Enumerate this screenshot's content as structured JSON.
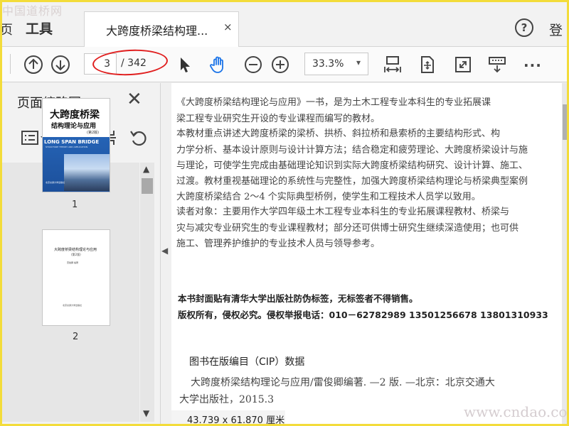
{
  "watermark": {
    "top": "中国道桥网",
    "bottom": "www.cndao.com"
  },
  "titlebar": {
    "left_stub": "页",
    "tools_tab": "工具",
    "doc_tab_title": "大跨度桥梁结构理...",
    "close_glyph": "×",
    "help_glyph": "?",
    "login_label": "登"
  },
  "toolbar": {
    "current_page": "3",
    "page_total": "/ 342",
    "zoom": "33.3%",
    "zoom_caret": "▾",
    "more_glyph": "···"
  },
  "panel": {
    "title": "页面缩略图",
    "close_glyph": "✕",
    "thumbnails": [
      {
        "label": "1",
        "cover_title": "大跨度桥梁",
        "cover_subtitle": "结构理论与应用",
        "cover_edition": "(第2版)",
        "cover_english": "LONG SPAN BRIDGE",
        "cover_english_sub": "STRUCTURE THEORY AND APPLICATION",
        "cover_publisher": "北京交通大学出版社"
      },
      {
        "label": "2",
        "title": "大跨度桥梁结构理论与应用",
        "edition": "(第2版)",
        "authors": "雷俊卿 编著",
        "publisher": "北京交通大学出版社"
      }
    ]
  },
  "document": {
    "lines": [
      "《大跨度桥梁结构理论与应用》一书，是为土木工程专业本科生的专业拓展课",
      "梁工程专业研究生开设的专业课程而编写的教材。",
      "    本教材重点讲述大跨度桥梁的梁桥、拱桥、斜拉桥和悬索桥的主要结构形式、构",
      "力学分析、基本设计原则与设计计算方法；结合稳定和疲劳理论、大跨度桥梁设计与施",
      "与理论，可使学生完成由基础理论知识到实际大跨度桥梁结构研究、设计计算、施工、",
      "过渡。教材重视基础理论的系统性与完整性，加强大跨度桥梁结构理论与桥梁典型案例",
      "大跨度桥梁结合 2～4 个实际典型桥例，使学生和工程技术人员学以致用。",
      "    读者对象：主要用作大学四年级土木工程专业本科生的专业拓展课程教材、桥梁与",
      "灾与减灾专业研究生的专业课程教材；部分还可供博士研究生继续深造使用；也可供",
      "施工、管理养护维护的专业技术人员与领导参考。"
    ],
    "notice": "本书封面贴有清华大学出版社防伪标签，无标签者不得销售。",
    "copyright": "版权所有，侵权必究。侵权举报电话：010－62782989    13501256678    13801310933",
    "cip_heading": "图书在版编目（CIP）数据",
    "cip_line1": "大跨度桥梁结构理论与应用/雷俊卿编著. —2 版. —北京：北京交通大",
    "cip_line2": "大学出版社，2015.3"
  },
  "status": {
    "page_size": "43.739 x 61.870 厘米"
  },
  "colors": {
    "accent_blue": "#1a73e8",
    "annotation_red": "#e01e1e",
    "frame_yellow": "#f3dc3a"
  }
}
